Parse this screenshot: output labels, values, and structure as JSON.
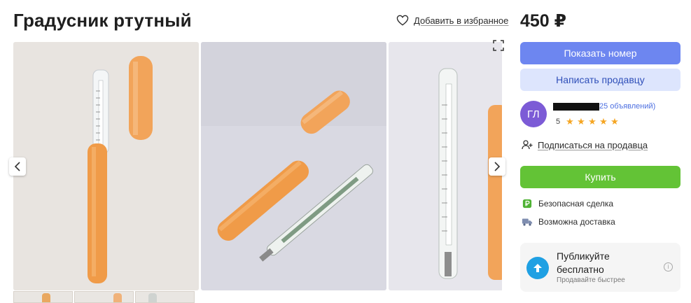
{
  "listing": {
    "title": "Градусник ртутный",
    "price": "450 ₽"
  },
  "favorites": {
    "label": "Добавить в избранное",
    "icon": "heart-icon"
  },
  "gallery": {
    "photos": [
      "thermometer-photo-1",
      "thermometer-photo-2",
      "thermometer-photo-3"
    ],
    "expand_icon": "expand-icon",
    "prev_icon": "chevron-left-icon",
    "next_icon": "chevron-right-icon"
  },
  "actions": {
    "show_phone": "Показать номер",
    "write_seller": "Написать продавцу",
    "buy": "Купить"
  },
  "seller": {
    "initials": "ГЛ",
    "ads_count": "25 объявлений)",
    "rating": "5",
    "stars": 5,
    "name_redacted": true
  },
  "subscribe": {
    "label": "Подписаться на продавца",
    "icon": "user-plus-icon"
  },
  "features": [
    {
      "label": "Безопасная сделка",
      "icon": "ruble-shield-icon"
    },
    {
      "label": "Возможна доставка",
      "icon": "truck-icon"
    }
  ],
  "promo": {
    "title": "Публикуйте бесплатно",
    "subtitle": "Продавайте быстрее",
    "icon": "arrow-up-icon",
    "info_icon": "info-icon"
  },
  "colors": {
    "primary_blue": "#6d86f0",
    "light_blue": "#dde5fd",
    "buy_green": "#63c336",
    "avatar_purple": "#7c5bd6",
    "star_orange": "#f5a623",
    "promo_blue": "#1fa0e3"
  }
}
